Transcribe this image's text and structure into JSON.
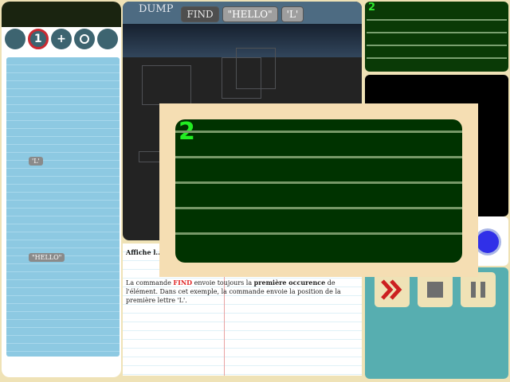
{
  "left": {
    "buttons": [
      {
        "icon": "blank-icon",
        "label": ""
      },
      {
        "icon": "one-icon",
        "label": "1",
        "active": true
      },
      {
        "icon": "plus-icon",
        "label": "+"
      },
      {
        "icon": "ring-icon",
        "label": ""
      },
      {
        "icon": "blank-icon",
        "label": ""
      }
    ],
    "tokens": [
      "'L'",
      "\"HELLO\""
    ]
  },
  "dump": {
    "label": "DUMP",
    "command": "FIND",
    "arg1": "\"HELLO\"",
    "arg2": "'L'"
  },
  "mini_display": {
    "value": "2"
  },
  "popup": {
    "value": "2"
  },
  "doc": {
    "heading": "Affiche l... sur la sor...",
    "body_pre": "La commande ",
    "keyword": "FIND",
    "body_mid": " envoie toujours la ",
    "emphasis": "première occurence",
    "body_post": " de l'élément. Dans cet exemple, la commande envoie la position de la première lettre 'L'."
  },
  "controls": {
    "run": "run-icon",
    "stop": "stop-icon",
    "pause": "pause-icon"
  },
  "colors": {
    "display_bg": "#003300",
    "display_text": "#22ee22",
    "popup_frame": "#f5deb3",
    "active_ring": "#cc2a32",
    "controls_bg": "#57aeb0",
    "run_arrow": "#cc2020"
  }
}
